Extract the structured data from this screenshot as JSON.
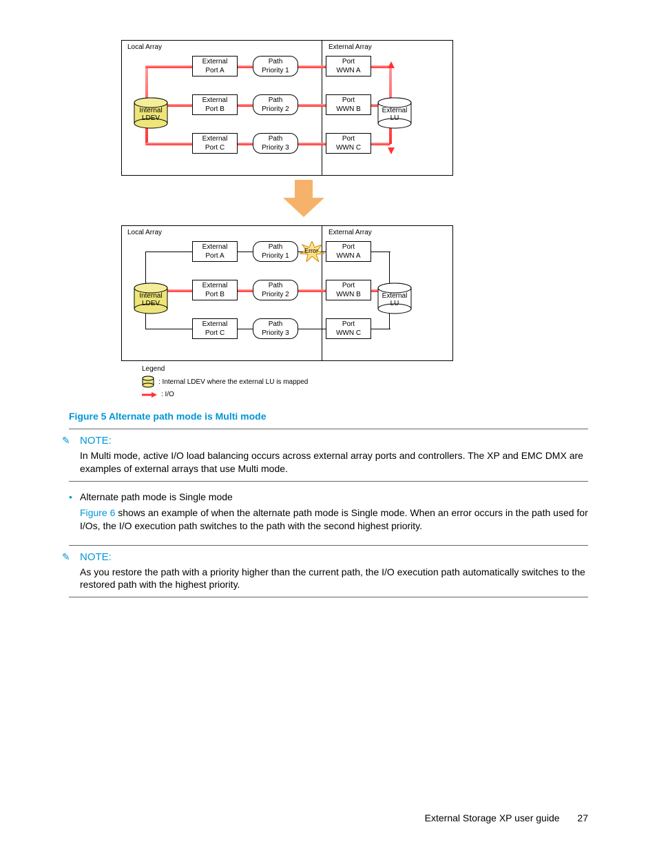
{
  "diagram": {
    "top": {
      "local_label": "Local Array",
      "external_label": "External Array",
      "ldev_line1": "Internal",
      "ldev_line2": "LDEV",
      "lu_line1": "External",
      "lu_line2": "LU",
      "rows": [
        {
          "ext": "External",
          "extport": "Port A",
          "path": "Path",
          "prio": "Priority 1",
          "port": "Port",
          "wwn": "WWN A"
        },
        {
          "ext": "External",
          "extport": "Port B",
          "path": "Path",
          "prio": "Priority 2",
          "port": "Port",
          "wwn": "WWN B"
        },
        {
          "ext": "External",
          "extport": "Port C",
          "path": "Path",
          "prio": "Priority 3",
          "port": "Port",
          "wwn": "WWN C"
        }
      ]
    },
    "bottom": {
      "local_label": "Local Array",
      "external_label": "External Array",
      "ldev_line1": "Internal",
      "ldev_line2": "LDEV",
      "lu_line1": "External",
      "lu_line2": "LU",
      "error_label": "Error",
      "rows": [
        {
          "ext": "External",
          "extport": "Port A",
          "path": "Path",
          "prio": "Priority 1",
          "port": "Port",
          "wwn": "WWN A"
        },
        {
          "ext": "External",
          "extport": "Port B",
          "path": "Path",
          "prio": "Priority 2",
          "port": "Port",
          "wwn": "WWN B"
        },
        {
          "ext": "External",
          "extport": "Port C",
          "path": "Path",
          "prio": "Priority 3",
          "port": "Port",
          "wwn": "WWN C"
        }
      ]
    },
    "legend": {
      "title": "Legend",
      "item1": ": Internal LDEV where the external LU is mapped",
      "item2": ": I/O"
    }
  },
  "figure_caption": "Figure 5 Alternate path mode is Multi mode",
  "note1": {
    "label": "NOTE:",
    "text": "In Multi mode, active I/O load balancing occurs across external array ports and controllers. The XP and EMC DMX are examples of external arrays that use Multi mode."
  },
  "bullet": {
    "text": "Alternate path mode is Single mode",
    "link": "Figure 6",
    "para": " shows an example of when the alternate path mode is Single mode. When an error occurs in the path used for I/Os, the I/O execution path switches to the path with the second highest priority."
  },
  "note2": {
    "label": "NOTE:",
    "text": "As you restore the path with a priority higher than the current path, the I/O execution path automatically switches to the restored path with the highest priority."
  },
  "footer": {
    "title": "External Storage XP user guide",
    "page": "27"
  }
}
